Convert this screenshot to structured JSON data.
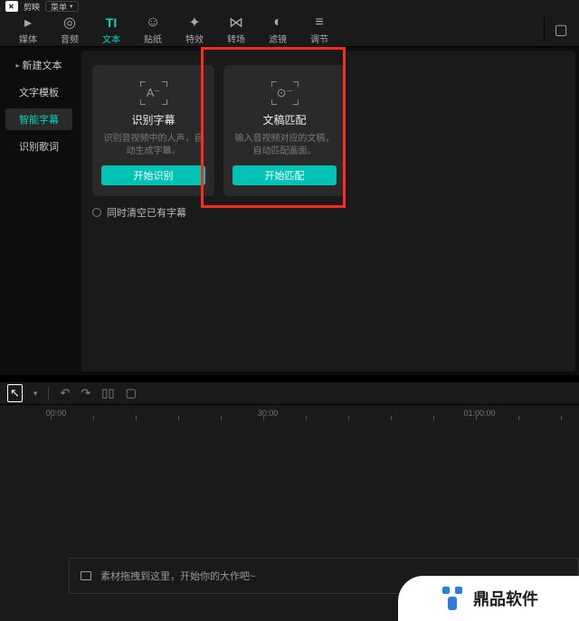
{
  "titlebar": {
    "app_name": "剪映",
    "menu_label": "菜单"
  },
  "tabs": [
    {
      "label": "媒体"
    },
    {
      "label": "音频"
    },
    {
      "label": "文本"
    },
    {
      "label": "贴纸"
    },
    {
      "label": "特效"
    },
    {
      "label": "转场"
    },
    {
      "label": "滤镜"
    },
    {
      "label": "调节"
    }
  ],
  "sidebar": {
    "items": [
      "新建文本",
      "文字模板",
      "智能字幕",
      "识别歌词"
    ],
    "active_index": 2
  },
  "cards": [
    {
      "title": "识别字幕",
      "desc": "识别音视频中的人声，自动生成字幕。",
      "button": "开始识别",
      "glyph": "A⁻"
    },
    {
      "title": "文稿匹配",
      "desc": "输入音视频对应的文稿，自动匹配画面。",
      "button": "开始匹配",
      "glyph": "⊙⁻"
    }
  ],
  "clear_caption": "同时清空已有字幕",
  "timeline": {
    "ticks": [
      "00:00",
      "30:00",
      "01:00:00"
    ],
    "track_hint": "素材拖拽到这里，开始你的大作吧~"
  },
  "watermark": {
    "text": "鼎品软件"
  }
}
